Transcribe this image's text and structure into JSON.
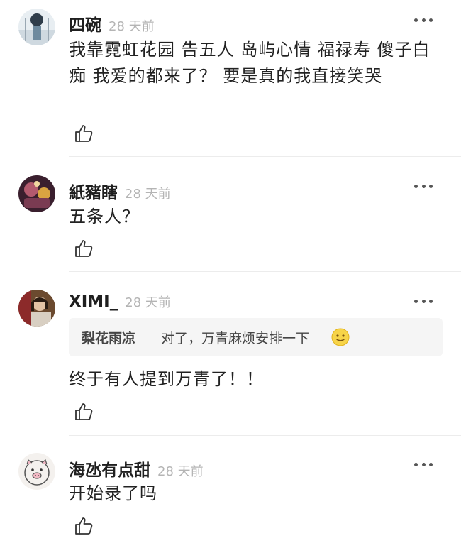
{
  "comments": [
    {
      "username": "四碗",
      "time": "28 天前",
      "text": "我靠霓虹花园 告五人 岛屿心情 福禄寿 傻子白痴 我爱的都来了？ 要是真的我直接笑哭"
    },
    {
      "username": "紙豬瞎",
      "time": "28 天前",
      "text": "五条人？"
    },
    {
      "username": "XIMI_",
      "time": "28 天前",
      "quote": {
        "author": "梨花雨凉",
        "text": "对了，万青麻烦安排一下",
        "emoji": "smile-emoji"
      },
      "text": "终于有人提到万青了！！"
    },
    {
      "username": "海氹有点甜",
      "time": "28 天前",
      "text": "开始录了吗"
    }
  ],
  "icons": {
    "more": "more-icon",
    "like": "thumbs-up-icon"
  },
  "colors": {
    "username": "#1f1f1f",
    "timestamp": "#b4b4b4",
    "text": "#222222",
    "quote_bg": "#f5f5f5",
    "divider": "#ececec"
  }
}
